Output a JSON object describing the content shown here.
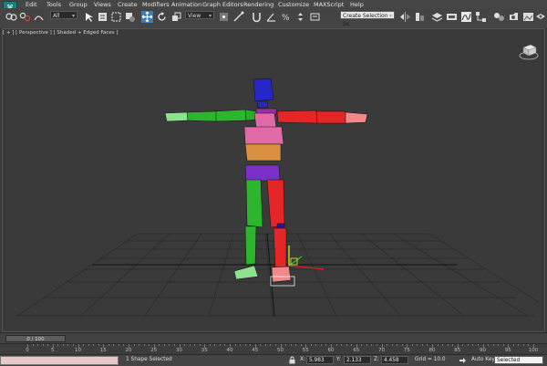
{
  "menu": [
    "Edit",
    "Tools",
    "Group",
    "Views",
    "Create",
    "Modifiers",
    "Animation",
    "Graph Editors",
    "Rendering",
    "Customize",
    "MAXScript",
    "Help"
  ],
  "toolbar": {
    "selection_filter": "All",
    "reference_coord": "View",
    "named_selection": "Create Selection Se"
  },
  "viewport": {
    "label": "[ + ] [ Perspective ] [ Shaded + Edged Faces ]"
  },
  "timeline": {
    "frame_readout": "0 / 100",
    "ticks": [
      "0",
      "5",
      "10",
      "15",
      "20",
      "25",
      "30",
      "35",
      "40",
      "45",
      "50",
      "55",
      "60",
      "65",
      "70",
      "75",
      "80",
      "85",
      "90",
      "95",
      "100"
    ]
  },
  "status": {
    "selection": "1 Shape Selected",
    "x_label": "X:",
    "x_value": "5.983",
    "y_label": "Y:",
    "y_value": "2.133",
    "z_label": "Z:",
    "z_value": "4.458",
    "grid": "Grid = 10.0",
    "auto_key": "Auto Key",
    "key_mode": "Selected"
  },
  "colors": {
    "viewport_bg": "#3a3a3a",
    "left_limbs": "#2db52d",
    "right_limbs": "#e52626",
    "head": "#2626c8",
    "spine_pink": "#e06aa8",
    "pelvis": "#7a2fc8",
    "spine_orange": "#d99040"
  },
  "icons": [
    "select-link-icon",
    "unlink-icon",
    "bind-space-warp-icon",
    "select-object-icon",
    "select-by-name-icon",
    "rect-region-icon",
    "window-crossing-icon",
    "select-move-icon",
    "select-rotate-icon",
    "select-scale-icon",
    "pivot-icon",
    "manipulate-icon",
    "snap-toggle-icon",
    "angle-snap-icon",
    "percent-snap-icon",
    "spinner-snap-icon",
    "edit-named-sel-icon",
    "mirror-icon",
    "align-icon",
    "layer-manager-icon",
    "curve-editor-icon",
    "schematic-view-icon",
    "material-editor-icon",
    "render-setup-icon",
    "rendered-frame-icon",
    "render-icon"
  ]
}
